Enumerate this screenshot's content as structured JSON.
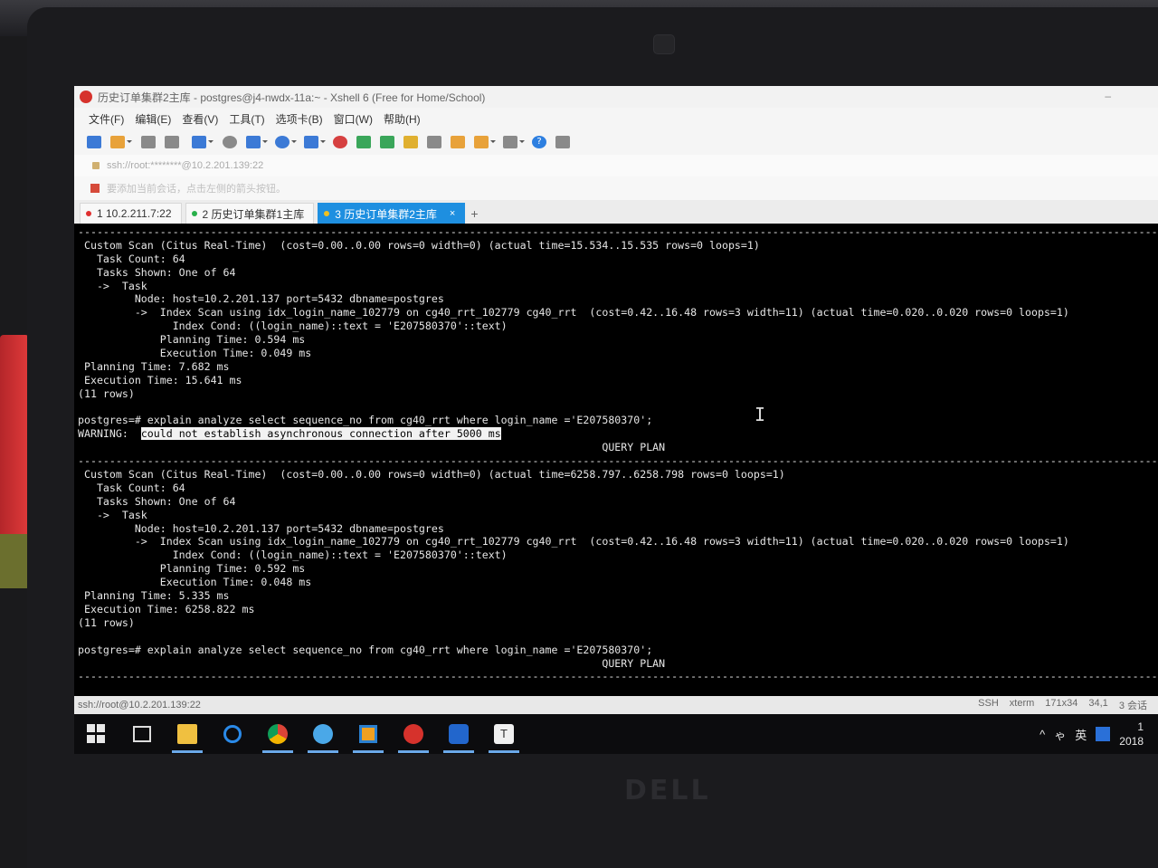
{
  "window": {
    "title": "历史订单集群2主库 - postgres@j4-nwdx-11a:~ - Xshell 6 (Free for Home/School)",
    "minimize": "–"
  },
  "menu": [
    "文件(F)",
    "编辑(E)",
    "查看(V)",
    "工具(T)",
    "选项卡(B)",
    "窗口(W)",
    "帮助(H)"
  ],
  "address": "ssh://root:********@10.2.201.139:22",
  "hint": "要添加当前会话，点击左侧的箭头按钮。",
  "tabs": [
    {
      "label": "1 10.2.211.7:22",
      "dot": "red",
      "active": false
    },
    {
      "label": "2 历史订单集群1主库",
      "dot": "green",
      "active": false
    },
    {
      "label": "3 历史订单集群2主库",
      "dot": "yellow",
      "active": true
    }
  ],
  "tab_close": "×",
  "tab_add": "+",
  "terminal": {
    "lines": [
      "----------------------------------------------------------------------------------------------------------------------------------------------------------------------------",
      " Custom Scan (Citus Real-Time)  (cost=0.00..0.00 rows=0 width=0) (actual time=15.534..15.535 rows=0 loops=1)",
      "   Task Count: 64",
      "   Tasks Shown: One of 64",
      "   ->  Task",
      "         Node: host=10.2.201.137 port=5432 dbname=postgres",
      "         ->  Index Scan using idx_login_name_102779 on cg40_rrt_102779 cg40_rrt  (cost=0.42..16.48 rows=3 width=11) (actual time=0.020..0.020 rows=0 loops=1)",
      "               Index Cond: ((login_name)::text = 'E207580370'::text)",
      "             Planning Time: 0.594 ms",
      "             Execution Time: 0.049 ms",
      " Planning Time: 7.682 ms",
      " Execution Time: 15.641 ms",
      "(11 rows)",
      "",
      "postgres=# explain analyze select sequence_no from cg40_rrt where login_name ='E207580370';"
    ],
    "warning_label": "WARNING:  ",
    "warning_text": "could not establish asynchronous connection after 5000 ms",
    "query_plan_1": "                                                                                   QUERY PLAN",
    "lines2": [
      "----------------------------------------------------------------------------------------------------------------------------------------------------------------------------",
      " Custom Scan (Citus Real-Time)  (cost=0.00..0.00 rows=0 width=0) (actual time=6258.797..6258.798 rows=0 loops=1)",
      "   Task Count: 64",
      "   Tasks Shown: One of 64",
      "   ->  Task",
      "         Node: host=10.2.201.137 port=5432 dbname=postgres",
      "         ->  Index Scan using idx_login_name_102779 on cg40_rrt_102779 cg40_rrt  (cost=0.42..16.48 rows=3 width=11) (actual time=0.020..0.020 rows=0 loops=1)",
      "               Index Cond: ((login_name)::text = 'E207580370'::text)",
      "             Planning Time: 0.592 ms",
      "             Execution Time: 0.048 ms",
      " Planning Time: 5.335 ms",
      " Execution Time: 6258.822 ms",
      "(11 rows)",
      "",
      "postgres=# explain analyze select sequence_no from cg40_rrt where login_name ='E207580370';",
      "                                                                                   QUERY PLAN",
      "----------------------------------------------------------------------------------------------------------------------------------------------------------------------------"
    ]
  },
  "statusbar": {
    "session": "ssh://root@10.2.201.139:22",
    "protocol": "SSH",
    "term": "xterm",
    "size": "171x34",
    "pos": "34,1",
    "sessions": "3 会话"
  },
  "tray": {
    "chevron": "^",
    "volume": "ゃ",
    "ime": "英",
    "clock_top": "1",
    "clock_bottom": "2018"
  },
  "brand": "DELL",
  "colors": {
    "active_tab": "#1e8fe0",
    "terminal_bg": "#000000",
    "terminal_fg": "#e6e6e6"
  }
}
